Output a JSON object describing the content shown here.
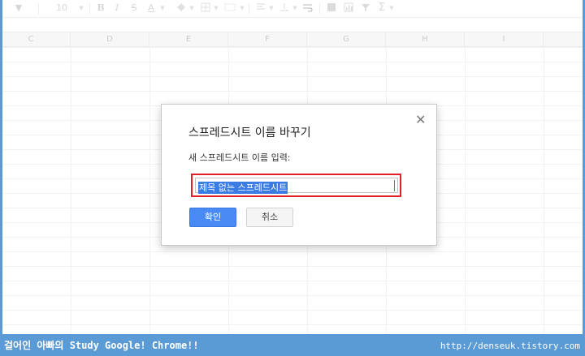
{
  "toolbar": {
    "font_size": "10",
    "bold": "B",
    "italic": "I",
    "strike": "S",
    "text_color": "A",
    "sum": "Σ"
  },
  "columns": [
    "C",
    "D",
    "E",
    "F",
    "G",
    "H",
    "I"
  ],
  "dialog": {
    "title": "스프레드시트 이름 바꾸기",
    "label": "새 스프레드시트 이름 입력:",
    "input_value": "제목 없는 스프레드시트",
    "ok_label": "확인",
    "cancel_label": "취소",
    "close_symbol": "✕"
  },
  "footer": {
    "left_text": "걸어인 아빠의 Study Google! Chrome!!",
    "right_text": "http://denseuk.tistory.com"
  },
  "colors": {
    "frame": "#5b9bd5",
    "primary_button": "#4a8af4",
    "highlight_border": "#e2202a",
    "selection": "#3b7ce4"
  }
}
